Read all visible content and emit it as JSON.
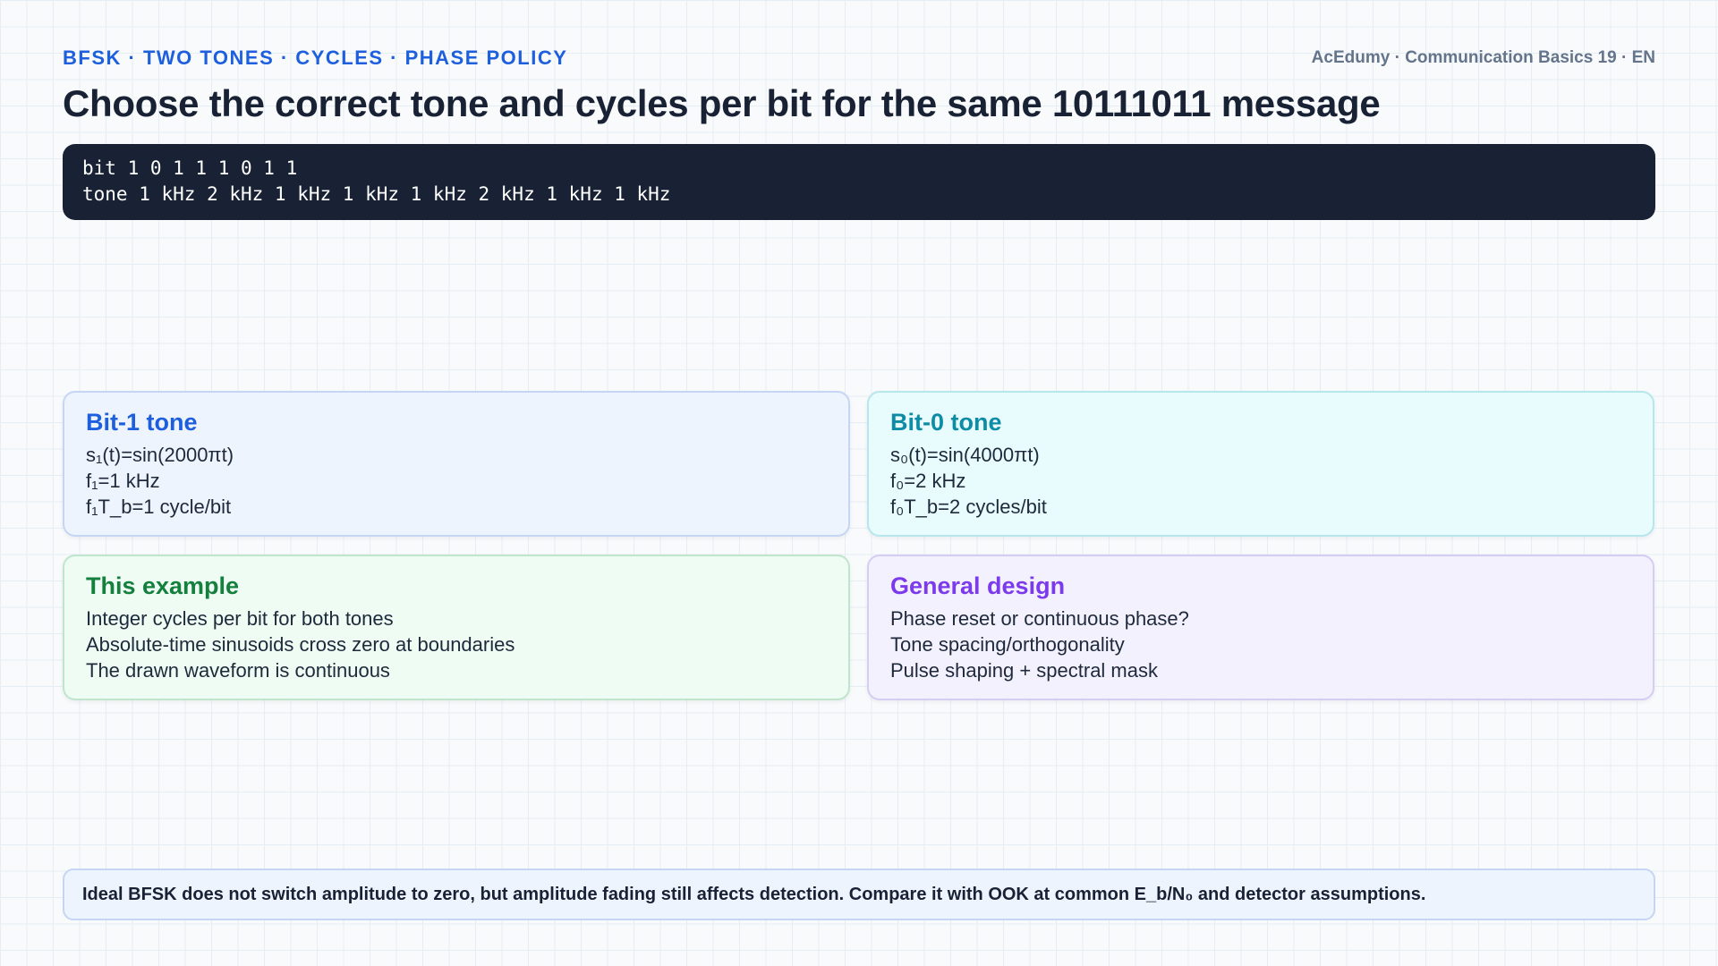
{
  "header": {
    "kicker": "BFSK · TWO TONES · CYCLES · PHASE POLICY",
    "brand": "AcEdumy · Communication Basics 19 · EN",
    "title": "Choose the correct tone and cycles per bit for the same 10111011 message"
  },
  "code": {
    "bit_line": "bit 1 0 1 1 1 0 1 1",
    "tone_line": "tone 1 kHz 2 kHz 1 kHz 1 kHz 1 kHz 2 kHz 1 kHz 1 kHz"
  },
  "cards": {
    "bit1": {
      "title": "Bit-1 tone",
      "lines": [
        "s₁(t)=sin(2000πt)",
        "f₁=1 kHz",
        "f₁T_b=1 cycle/bit"
      ]
    },
    "bit0": {
      "title": "Bit-0 tone",
      "lines": [
        "s₀(t)=sin(4000πt)",
        "f₀=2 kHz",
        "f₀T_b=2 cycles/bit"
      ]
    },
    "example": {
      "title": "This example",
      "lines": [
        "Integer cycles per bit for both tones",
        "Absolute-time sinusoids cross zero at boundaries",
        "The drawn waveform is continuous"
      ]
    },
    "design": {
      "title": "General design",
      "lines": [
        "Phase reset or continuous phase?",
        "Tone spacing/orthogonality",
        "Pulse shaping + spectral mask"
      ]
    }
  },
  "footnote": "Ideal BFSK does not switch amplitude to zero, but amplitude fading still affects detection. Compare it with OOK at common E_b/N₀ and detector assumptions."
}
